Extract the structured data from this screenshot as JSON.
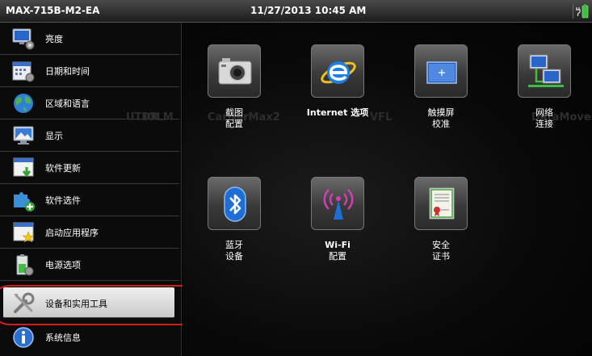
{
  "titlebar": {
    "device": "MAX-715B-M2-EA",
    "datetime": "11/27/2013 10:45 AM"
  },
  "sidebar": {
    "items": [
      {
        "label": "亮度",
        "icon": "monitor-settings-icon"
      },
      {
        "label": "日期和时间",
        "icon": "calendar-icon"
      },
      {
        "label": "区域和语言",
        "icon": "globe-icon"
      },
      {
        "label": "显示",
        "icon": "display-icon"
      },
      {
        "label": "软件更新",
        "icon": "software-update-icon"
      },
      {
        "label": "软件选件",
        "icon": "puzzle-icon"
      },
      {
        "label": "启动应用程序",
        "icon": "startup-app-icon"
      },
      {
        "label": "电源选项",
        "icon": "battery-icon"
      },
      {
        "label": "设备和实用工具",
        "icon": "tools-icon",
        "selected": true
      },
      {
        "label": "系统信息",
        "icon": "info-icon"
      }
    ]
  },
  "background_labels": [
    "UTDR",
    "iOLM",
    "Carrier",
    "torMax2",
    "VFL",
    "DataMover"
  ],
  "tiles": [
    {
      "line1": "截图",
      "line2": "配置",
      "icon": "camera-icon"
    },
    {
      "line1": "Internet 选项",
      "line2": "",
      "icon": "internet-explorer-icon"
    },
    {
      "line1": "触摸屏",
      "line2": "校准",
      "icon": "touchscreen-calibration-icon"
    },
    {
      "line1": "网络",
      "line2": "连接",
      "icon": "network-icon"
    },
    {
      "line1": "蓝牙",
      "line2": "设备",
      "icon": "bluetooth-icon"
    },
    {
      "line1": "Wi-Fi",
      "line2": "配置",
      "icon": "wifi-antenna-icon"
    },
    {
      "line1": "安全",
      "line2": "证书",
      "icon": "certificate-icon"
    }
  ],
  "colors": {
    "highlight": "#d21d1d",
    "accent_blue": "#1d6fd6"
  }
}
